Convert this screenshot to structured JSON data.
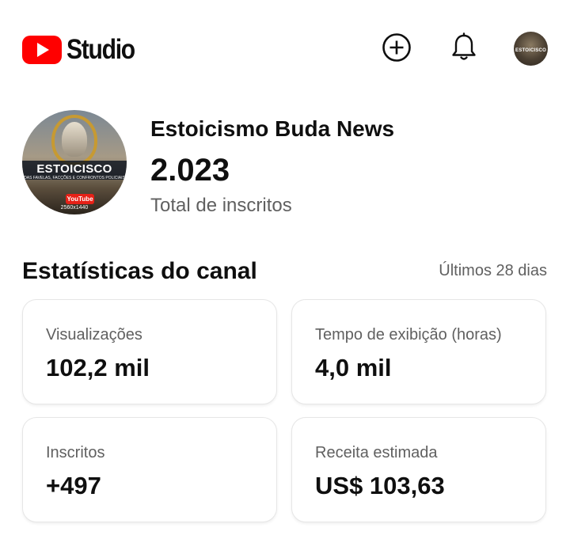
{
  "header": {
    "app_name": "Studio",
    "logo_icon": "youtube-play-icon",
    "create_icon": "plus-circle-icon",
    "notifications_icon": "bell-icon",
    "account_avatar_text": "ESTOICISCO",
    "brand_color": "#ff0000"
  },
  "channel": {
    "name": "Estoicismo Buda News",
    "subscriber_count": "2.023",
    "subscriber_label": "Total de inscritos",
    "avatar_title": "ESTOICISCO",
    "avatar_subtitle": "DAS FAVELAS, FACÇÕES E CONFRONTOS POLICIAIS",
    "avatar_badge": "YouTube",
    "avatar_resolution": "2560x1440"
  },
  "stats": {
    "title": "Estatísticas do canal",
    "range": "Últimos 28 dias",
    "cards": [
      {
        "label": "Visualizações",
        "value": "102,2 mil"
      },
      {
        "label": "Tempo de exibição (horas)",
        "value": "4,0 mil"
      },
      {
        "label": "Inscritos",
        "value": "+497"
      },
      {
        "label": "Receita estimada",
        "value": "US$ 103,63"
      }
    ]
  }
}
